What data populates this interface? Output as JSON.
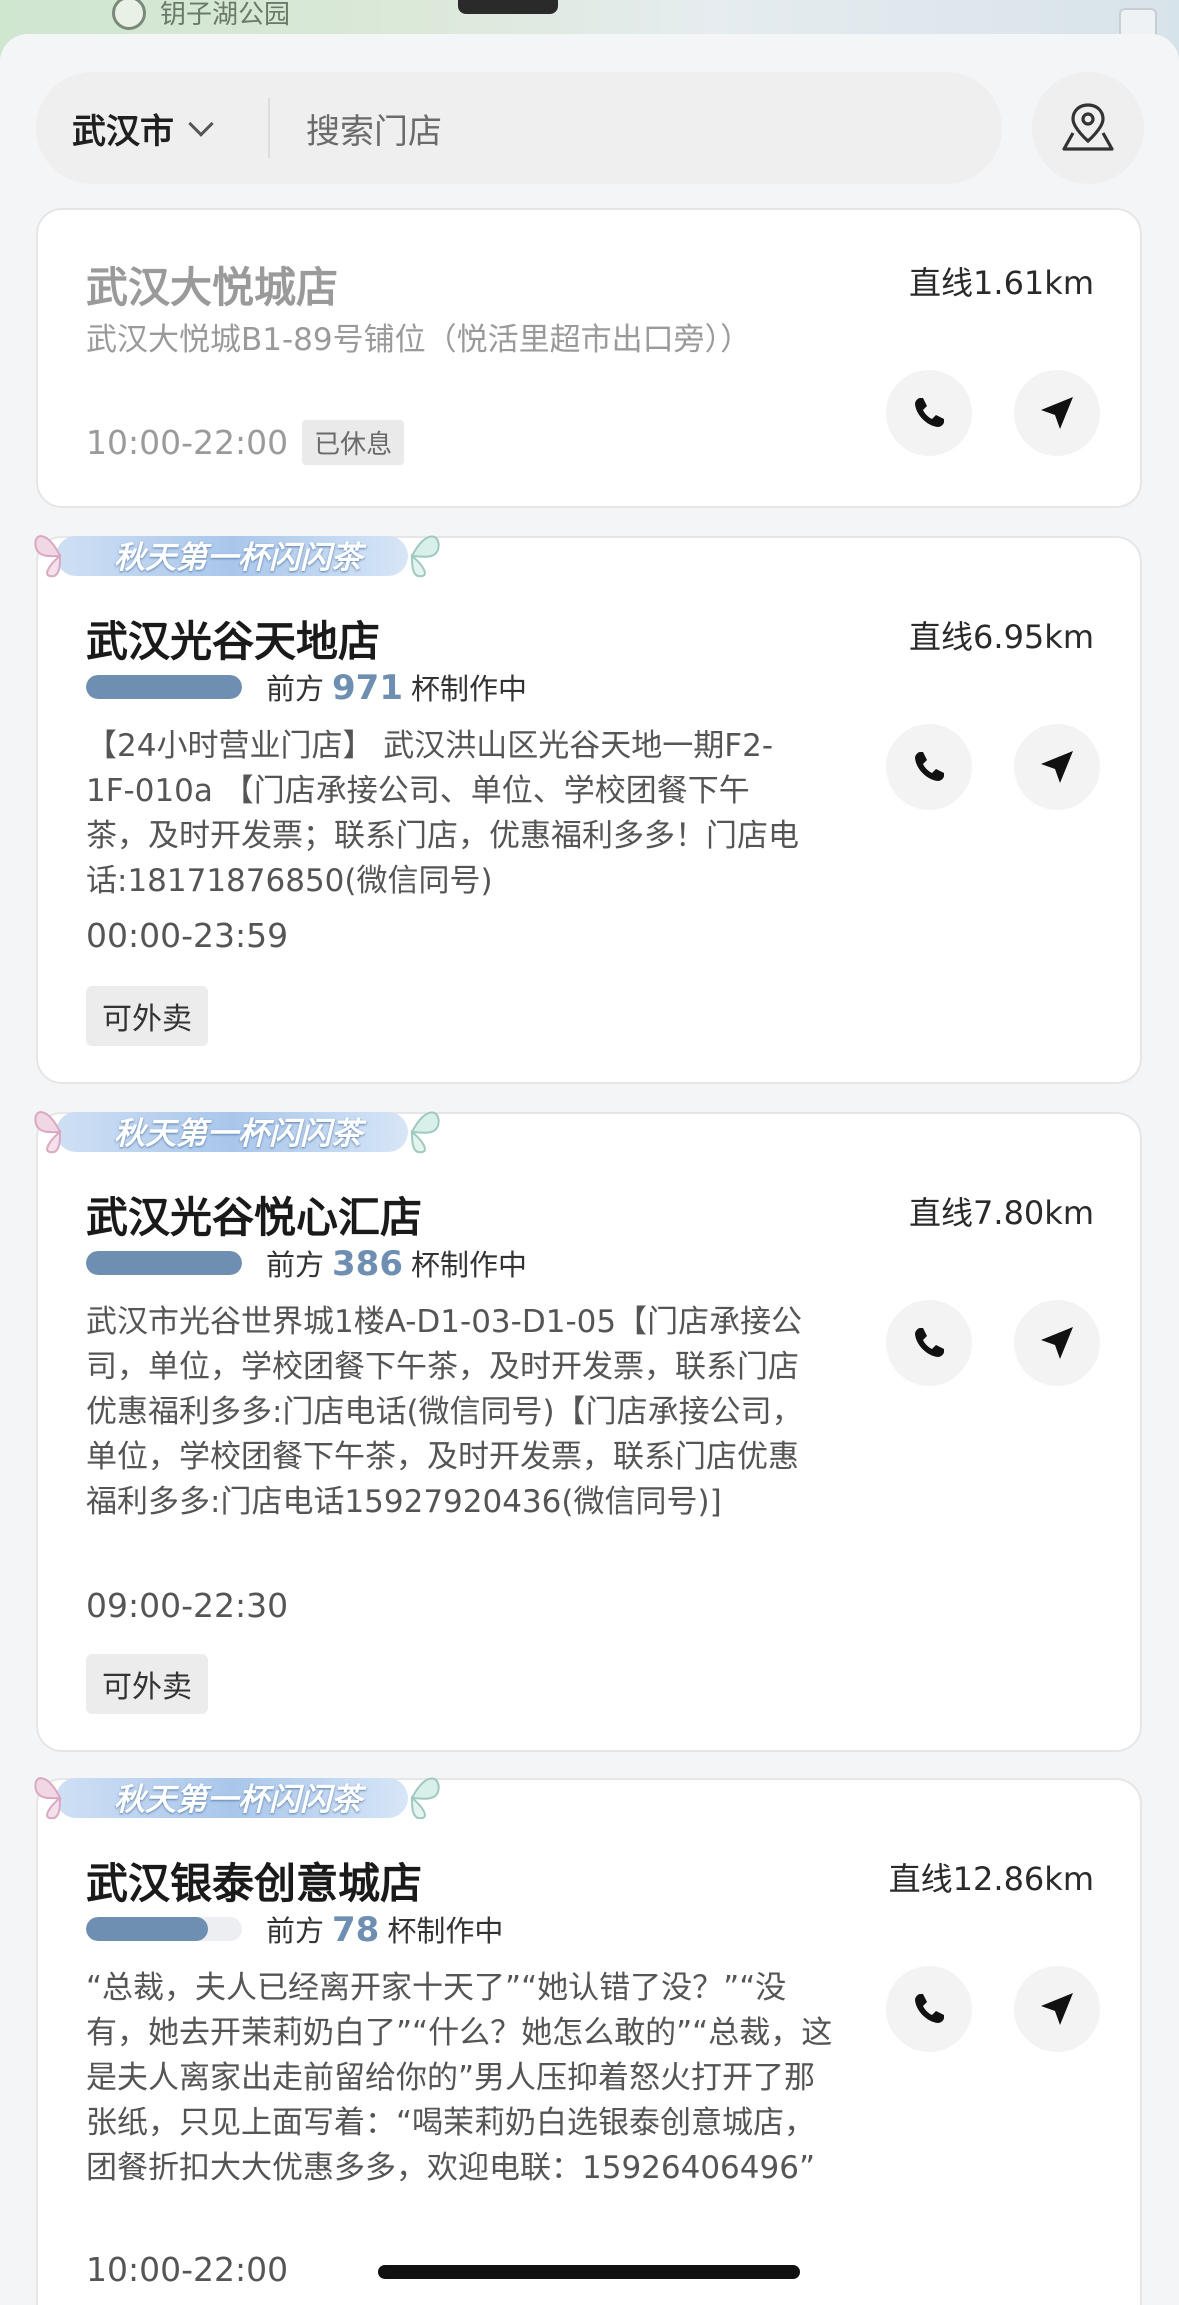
{
  "map": {
    "label_left": "钥子湖公园"
  },
  "search": {
    "city": "武汉市",
    "placeholder": "搜索门店"
  },
  "stores": [
    {
      "name": "武汉大悦城店",
      "distance": "直线1.61km",
      "address": "武汉大悦城B1-89号铺位（悦活里超市出口旁））",
      "hours": "10:00-22:00",
      "status_badge": "已休息",
      "status": "closed"
    },
    {
      "promo": "秋天第一杯闪闪茶",
      "name": "武汉光谷天地店",
      "distance": "直线6.95km",
      "queue_prefix": "前方",
      "queue_count": "971",
      "queue_suffix": "杯制作中",
      "queue_fill": 1.0,
      "address": "【24小时营业门店】 武汉洪山区光谷天地一期F2-1F-010a 【门店承接公司、单位、学校团餐下午茶，及时开发票；联系门店，优惠福利多多！门店电话:18171876850(微信同号)",
      "hours": "00:00-23:59",
      "tag": "可外卖"
    },
    {
      "promo": "秋天第一杯闪闪茶",
      "name": "武汉光谷悦心汇店",
      "distance": "直线7.80km",
      "queue_prefix": "前方",
      "queue_count": "386",
      "queue_suffix": "杯制作中",
      "queue_fill": 1.0,
      "address": "武汉市光谷世界城1楼A-D1-03-D1-05【门店承接公司，单位，学校团餐下午茶，及时开发票，联系门店优惠福利多多:门店电话(微信同号)【门店承接公司，单位，学校团餐下午茶，及时开发票，联系门店优惠福利多多:门店电话15927920436(微信同号)]",
      "hours": "09:00-22:30",
      "tag": "可外卖"
    },
    {
      "promo": "秋天第一杯闪闪茶",
      "name": "武汉银泰创意城店",
      "distance": "直线12.86km",
      "queue_prefix": "前方",
      "queue_count": "78",
      "queue_suffix": "杯制作中",
      "queue_fill": 0.78,
      "address": "“总裁，夫人已经离开家十天了”“她认错了没？”“没有，她去开茉莉奶白了”“什么？她怎么敢的”“总裁，这是夫人离家出走前留给你的”男人压抑着怒火打开了那张纸，只见上面写着：“喝茉莉奶白选银泰创意城店，团餐折扣大大优惠多多，欢迎电联：15926406496”",
      "hours": "10:00-22:00"
    }
  ],
  "icons": {
    "map": "map-location-icon",
    "phone": "phone-icon",
    "navigate": "navigate-arrow-icon",
    "chevron": "chevron-down-icon",
    "butterfly": "butterfly-icon"
  },
  "colors": {
    "accent": "#6e8fb2",
    "closed_text": "#9a9a9a"
  }
}
